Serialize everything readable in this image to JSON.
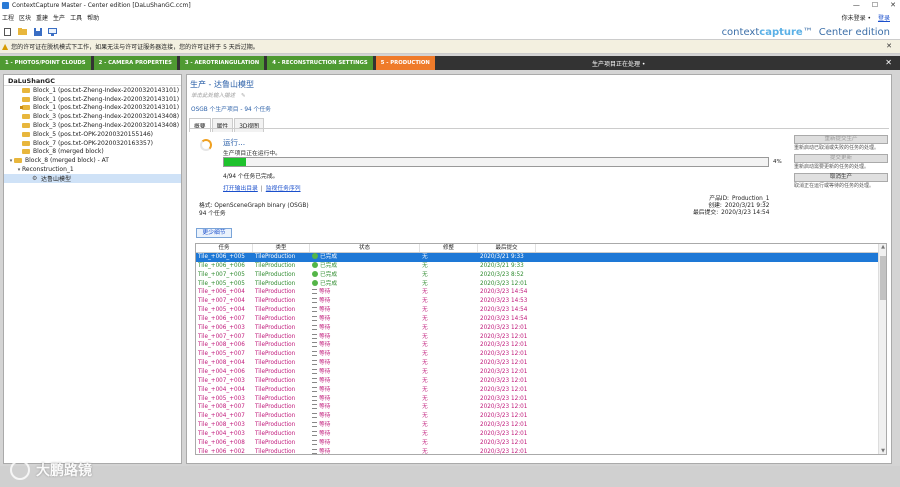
{
  "window": {
    "title": "ContextCapture Master - Center edition [DaLuShanGC.ccm]",
    "minimize": "—",
    "maximize": "☐",
    "close": "✕"
  },
  "menu": {
    "items": [
      "工程",
      "区块",
      "重建",
      "生产",
      "工具",
      "帮助"
    ],
    "login_prefix": "你未登录 •",
    "login_link": "登录"
  },
  "brand": {
    "name_a": "context",
    "name_b": "capture",
    "tm": "™",
    "edition": "Center edition"
  },
  "warning": {
    "text": "您的许可证在脱机模式下工作，如果无法与许可证服务器连接，您的许可证将于 5 天后过期。",
    "close": "✕"
  },
  "steps": [
    {
      "label": "1 - PHOTOS/POINT CLOUDS",
      "state": "done"
    },
    {
      "label": "2 - CAMERA PROPERTIES",
      "state": "done"
    },
    {
      "label": "3 - AEROTRIANGULATION",
      "state": "done"
    },
    {
      "label": "4 - RECONSTRUCTION SETTINGS",
      "state": "done"
    },
    {
      "label": "5 - PRODUCTION",
      "state": "active"
    }
  ],
  "stepbar": {
    "status": "生产项目正在处理 •",
    "close": "✕"
  },
  "tree": {
    "root": "DaLuShanGC",
    "items": [
      {
        "label": "Block_1 (pos.txt-Zheng-Index-20200320143101)",
        "lock": false
      },
      {
        "label": "Block_1 (pos.txt-Zheng-Index-20200320143101)",
        "lock": false
      },
      {
        "label": "Block_1 (pos.txt-Zheng-Index-20200320143101)",
        "lock": true
      },
      {
        "label": "Block_3 (pos.txt-Zheng-Index-20200320143408)",
        "lock": false
      },
      {
        "label": "Block_3 (pos.txt-Zheng-Index-20200320143408)",
        "lock": false
      },
      {
        "label": "Block_5 (pos.txt-OPK-20200320155146)",
        "lock": false
      },
      {
        "label": "Block_7 (pos.txt-OPK-20200320163357)",
        "lock": false
      },
      {
        "label": "Block_8 (merged block)",
        "lock": false
      },
      {
        "label": "Block_8 (merged block) - AT",
        "lock": false
      }
    ],
    "reconstruction": "Reconstruction_1",
    "production": "达鲁山模型"
  },
  "production": {
    "title": "生产 - 达鲁山模型",
    "description": "单击此处输入描述",
    "pen": "✎",
    "info": "OSGB 个生产项目 - 94 个任务",
    "tabs": [
      "概要",
      "属性",
      "3D视图"
    ],
    "running": "运行...",
    "running_sub": "生产项目正在运行中。",
    "progress_pct": "4%",
    "progress_value": 0.04,
    "done_count": "4/94 个任务已完成。",
    "link_open": "打开输出目录",
    "link_sep": "|",
    "link_monitor": "监视任务序列",
    "format_line": "格式: OpenSceneGraph binary (OSGB)",
    "task_line": "94 个任务",
    "meta": [
      {
        "k": "产品ID:",
        "v": "Production_1"
      },
      {
        "k": "创建:",
        "v": "2020/3/21 9:32"
      },
      {
        "k": "最后提交:",
        "v": "2020/3/23 14:54"
      }
    ],
    "actions": [
      {
        "label": "重新提交生产",
        "desc": "重新启动已取消或失败的任务的处理。",
        "disabled": true
      },
      {
        "label": "提交更新",
        "desc": "重新启动需要更新的任务的处理。",
        "disabled": true
      },
      {
        "label": "取消生产",
        "desc": "取消正在运行或等待的任务的处理。",
        "disabled": false
      }
    ],
    "less_details": "更少细节"
  },
  "table": {
    "headers": [
      "任务",
      "类型",
      "状态",
      "修整",
      "最后提交"
    ],
    "rows": [
      {
        "task": "Tile_+006_+005",
        "type": "TileProduction",
        "status": "已完成",
        "trim": "无",
        "date": "2020/3/21 9:33",
        "state": "sel"
      },
      {
        "task": "Tile_+006_+006",
        "type": "TileProduction",
        "status": "已完成",
        "trim": "无",
        "date": "2020/3/21 9:33",
        "state": "done"
      },
      {
        "task": "Tile_+007_+005",
        "type": "TileProduction",
        "status": "已完成",
        "trim": "无",
        "date": "2020/3/23 8:52",
        "state": "done"
      },
      {
        "task": "Tile_+005_+005",
        "type": "TileProduction",
        "status": "已完成",
        "trim": "无",
        "date": "2020/3/23 12:01",
        "state": "done"
      },
      {
        "task": "Tile_+006_+004",
        "type": "TileProduction",
        "status": "等待",
        "trim": "无",
        "date": "2020/3/23 14:54",
        "state": "wait"
      },
      {
        "task": "Tile_+007_+004",
        "type": "TileProduction",
        "status": "等待",
        "trim": "无",
        "date": "2020/3/23 14:53",
        "state": "wait"
      },
      {
        "task": "Tile_+005_+004",
        "type": "TileProduction",
        "status": "等待",
        "trim": "无",
        "date": "2020/3/23 14:54",
        "state": "wait"
      },
      {
        "task": "Tile_+006_+007",
        "type": "TileProduction",
        "status": "等待",
        "trim": "无",
        "date": "2020/3/23 14:54",
        "state": "wait"
      },
      {
        "task": "Tile_+006_+003",
        "type": "TileProduction",
        "status": "等待",
        "trim": "无",
        "date": "2020/3/23 12:01",
        "state": "wait"
      },
      {
        "task": "Tile_+007_+007",
        "type": "TileProduction",
        "status": "等待",
        "trim": "无",
        "date": "2020/3/23 12:01",
        "state": "wait"
      },
      {
        "task": "Tile_+008_+006",
        "type": "TileProduction",
        "status": "等待",
        "trim": "无",
        "date": "2020/3/23 12:01",
        "state": "wait"
      },
      {
        "task": "Tile_+005_+007",
        "type": "TileProduction",
        "status": "等待",
        "trim": "无",
        "date": "2020/3/23 12:01",
        "state": "wait"
      },
      {
        "task": "Tile_+008_+004",
        "type": "TileProduction",
        "status": "等待",
        "trim": "无",
        "date": "2020/3/23 12:01",
        "state": "wait"
      },
      {
        "task": "Tile_+004_+006",
        "type": "TileProduction",
        "status": "等待",
        "trim": "无",
        "date": "2020/3/23 12:01",
        "state": "wait"
      },
      {
        "task": "Tile_+007_+003",
        "type": "TileProduction",
        "status": "等待",
        "trim": "无",
        "date": "2020/3/23 12:01",
        "state": "wait"
      },
      {
        "task": "Tile_+004_+004",
        "type": "TileProduction",
        "status": "等待",
        "trim": "无",
        "date": "2020/3/23 12:01",
        "state": "wait"
      },
      {
        "task": "Tile_+005_+003",
        "type": "TileProduction",
        "status": "等待",
        "trim": "无",
        "date": "2020/3/23 12:01",
        "state": "wait"
      },
      {
        "task": "Tile_+008_+007",
        "type": "TileProduction",
        "status": "等待",
        "trim": "无",
        "date": "2020/3/23 12:01",
        "state": "wait"
      },
      {
        "task": "Tile_+004_+007",
        "type": "TileProduction",
        "status": "等待",
        "trim": "无",
        "date": "2020/3/23 12:01",
        "state": "wait"
      },
      {
        "task": "Tile_+008_+003",
        "type": "TileProduction",
        "status": "等待",
        "trim": "无",
        "date": "2020/3/23 12:01",
        "state": "wait"
      },
      {
        "task": "Tile_+004_+003",
        "type": "TileProduction",
        "status": "等待",
        "trim": "无",
        "date": "2020/3/23 12:01",
        "state": "wait"
      },
      {
        "task": "Tile_+006_+008",
        "type": "TileProduction",
        "status": "等待",
        "trim": "无",
        "date": "2020/3/23 12:01",
        "state": "wait"
      },
      {
        "task": "Tile_+006_+002",
        "type": "TileProduction",
        "status": "等待",
        "trim": "无",
        "date": "2020/3/23 12:01",
        "state": "wait"
      }
    ]
  },
  "watermark": {
    "text": "大鹏路镜"
  },
  "colors": {
    "accent": "#2a5fa8",
    "done": "#2d8a2d",
    "wait": "#c0187a",
    "step_done": "#4f9a32",
    "step_active": "#ef7b2a",
    "progress": "#1ec22c"
  },
  "icons": {
    "spinner": "loading-spinner-icon",
    "done": "check-circle-icon",
    "wait": "hourglass-icon"
  }
}
